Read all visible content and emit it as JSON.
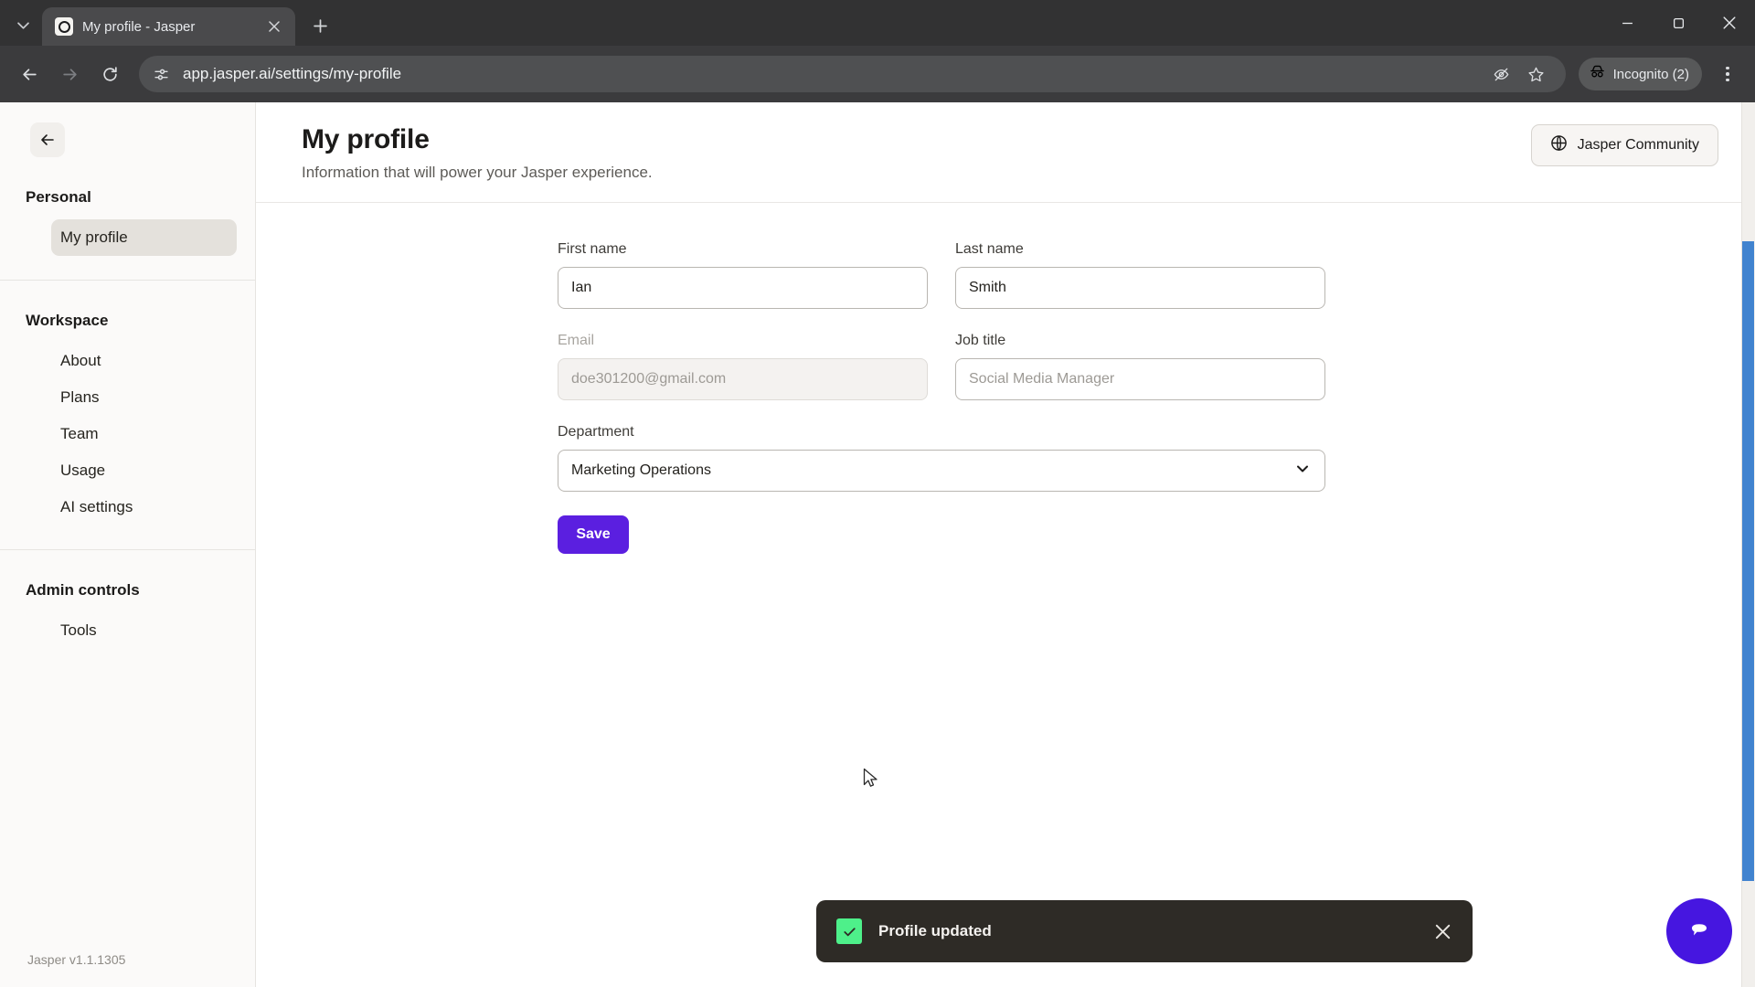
{
  "browser": {
    "tab": {
      "title": "My profile - Jasper",
      "favicon_name": "jasper-favicon",
      "close_label": "×"
    },
    "tab_list_button": "tab-search",
    "new_tab_label": "+",
    "window": {
      "minimize": "—",
      "maximize": "□",
      "close": "×"
    },
    "toolbar": {
      "back": "←",
      "forward": "→",
      "reload": "⟳",
      "site_info_icon": "page-settings-icon",
      "url": "app.jasper.ai/settings/my-profile",
      "url_placeholder": "Search Google or type a URL",
      "tracking_protection_icon": "eye-off-icon",
      "bookmark_icon": "star-icon",
      "profile_label": "Incognito (2)",
      "profile_icon": "incognito-icon",
      "menu_icon": "three-dot-menu-icon"
    }
  },
  "sidebar": {
    "back_button": "←",
    "groups": [
      {
        "title": "Personal",
        "items": [
          {
            "label": "My profile",
            "active": true
          }
        ]
      },
      {
        "title": "Workspace",
        "items": [
          {
            "label": "About",
            "active": false
          },
          {
            "label": "Plans",
            "active": false
          },
          {
            "label": "Team",
            "active": false
          },
          {
            "label": "Usage",
            "active": false
          },
          {
            "label": "AI settings",
            "active": false
          }
        ]
      },
      {
        "title": "Admin controls",
        "items": [
          {
            "label": "Tools",
            "active": false
          }
        ]
      }
    ],
    "version": "Jasper v1.1.1305"
  },
  "header": {
    "title": "My profile",
    "subtitle": "Information that will power your Jasper experience.",
    "community_button": {
      "label": "Jasper Community",
      "icon": "globe-icon"
    }
  },
  "form": {
    "first_name": {
      "label": "First name",
      "value": "Ian",
      "placeholder": "First name",
      "disabled": false
    },
    "last_name": {
      "label": "Last name",
      "value": "Smith",
      "placeholder": "Last name",
      "disabled": false
    },
    "email": {
      "label": "Email",
      "value": "doe301200@gmail.com",
      "placeholder": "doe301200@gmail.com",
      "disabled": true
    },
    "job_title": {
      "label": "Job title",
      "value": "",
      "placeholder": "Social Media Manager",
      "disabled": false
    },
    "department": {
      "label": "Department",
      "value": "Marketing Operations",
      "chevron_icon": "chevron-down-icon"
    },
    "save_button": "Save"
  },
  "toast": {
    "message": "Profile updated",
    "status_icon": "check-icon",
    "close_label": "×",
    "accent_color": "#4ef08a",
    "background_color": "#2e2b26"
  },
  "chat_widget": {
    "icon": "chat-bubble-icon",
    "color": "#4616E0"
  },
  "colors": {
    "primary": "#5B1FE0",
    "sidebar_bg": "#fbfaf9",
    "active_item": "#e4e1dc"
  }
}
